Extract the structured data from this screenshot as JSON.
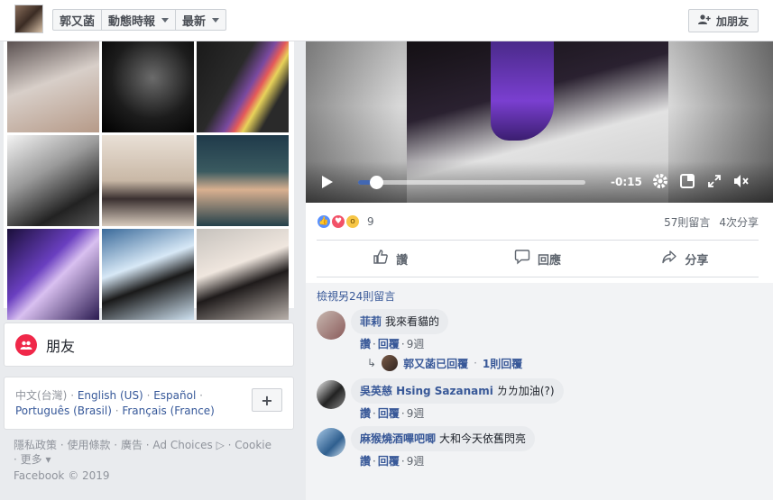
{
  "topbar": {
    "profile_name": "郭又菡",
    "timeline_label": "動態時報",
    "sort_label": "最新",
    "add_friend_label": "加朋友"
  },
  "friends_box": {
    "label": "朋友"
  },
  "languages": {
    "line1": [
      "中文(台灣)",
      "English (US)",
      "Español"
    ],
    "line2": [
      "Português (Brasil)",
      "Français (France)"
    ],
    "plus": "+"
  },
  "footer": {
    "links": [
      "隱私政策",
      "使用條款",
      "廣告",
      "Ad Choices",
      "Cookie"
    ],
    "more": "更多",
    "copyright": "Facebook © 2019"
  },
  "video": {
    "time_remaining": "-0:15",
    "progress": 0.06
  },
  "post": {
    "reaction_count": "9",
    "comments_count": "57則留言",
    "shares_count": "4次分享",
    "actions": [
      "讚",
      "回應",
      "分享"
    ]
  },
  "comments": {
    "view_more": "檢視另24則留言",
    "items": [
      {
        "name": "菲莉",
        "text": "我來看貓的",
        "like": "讚",
        "reply": "回覆",
        "age": "9週"
      },
      {
        "name": "吳英慈 Hsing Sazanami",
        "text": "ㄌㄌ加油(?)",
        "like": "讚",
        "reply": "回覆",
        "age": "9週"
      },
      {
        "name": "麻猴燒酒嗶吧唧",
        "text": "大和今天依舊閃亮",
        "like": "讚",
        "reply": "回覆",
        "age": "9週"
      }
    ],
    "reply_summary": {
      "author_replied": "郭又菡已回覆",
      "replies": "1則回覆"
    }
  },
  "icons": {
    "like": "thumbs-up-icon",
    "comment": "comment-bubble-icon",
    "share": "share-arrow-icon"
  },
  "colors": {
    "link_blue": "#385898",
    "brand_blue": "#4267b2",
    "friends_red": "#f02849"
  }
}
